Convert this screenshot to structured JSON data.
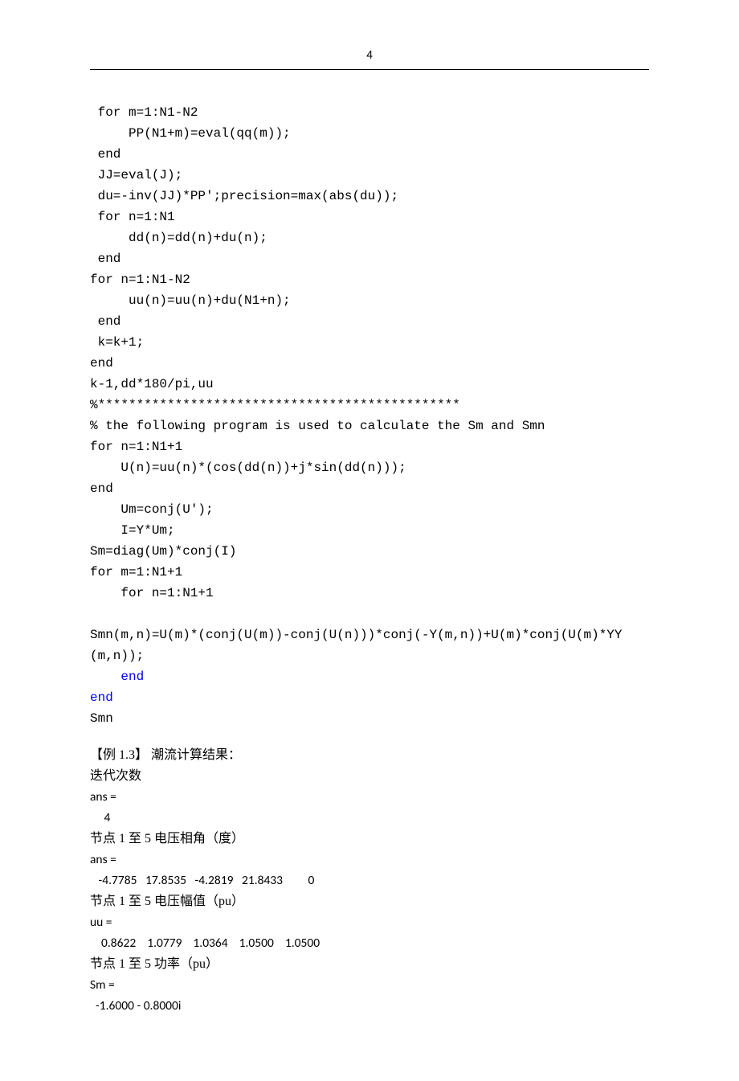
{
  "page_number": "4",
  "code": {
    "l1": " for m=1:N1-N2",
    "l2": "     PP(N1+m)=eval(qq(m));",
    "l3": " end",
    "l4": " JJ=eval(J);",
    "l5": " du=-inv(JJ)*PP';precision=max(abs(du));",
    "l6": " for n=1:N1",
    "l7": "     dd(n)=dd(n)+du(n);",
    "l8": " end",
    "l9": "for n=1:N1-N2",
    "l10": "     uu(n)=uu(n)+du(N1+n);",
    "l11": " end",
    "l12": " k=k+1;",
    "l13": "end",
    "l14": "k-1,dd*180/pi,uu",
    "l15": "%***********************************************",
    "l16": "% the following program is used to calculate the Sm and Smn",
    "l17": "for n=1:N1+1",
    "l18": "    U(n)=uu(n)*(cos(dd(n))+j*sin(dd(n)));",
    "l19": "end",
    "l20": "    Um=conj(U');",
    "l21": "    I=Y*Um;",
    "l22": "Sm=diag(Um)*conj(I)",
    "l23": "for m=1:N1+1",
    "l24": "    for n=1:N1+1",
    "l25": "",
    "l26": "Smn(m,n)=U(m)*(conj(U(m))-conj(U(n)))*conj(-Y(m,n))+U(m)*conj(U(m)*YY",
    "l27": "(m,n));",
    "l28a": "    ",
    "l28b": "end",
    "l29": "end",
    "l30": "Smn"
  },
  "results": {
    "title": "【例 1.3】  潮流计算结果：",
    "iter_label": "迭代次数",
    "ans_label_1": "ans =",
    "iter_value": "     4",
    "angle_label": "节点 1 至 5 电压相角（度）",
    "ans_label_2": "ans =",
    "angle_values": "   -4.7785   17.8535   -4.2819   21.8433         0",
    "mag_label": "节点 1 至 5 电压幅值（pu）",
    "uu_label": "uu =",
    "mag_values": "    0.8622    1.0779    1.0364    1.0500    1.0500",
    "power_label": "节点 1 至 5 功率（pu）",
    "sm_label": "Sm =",
    "sm_value": "  -1.6000 - 0.8000i"
  }
}
